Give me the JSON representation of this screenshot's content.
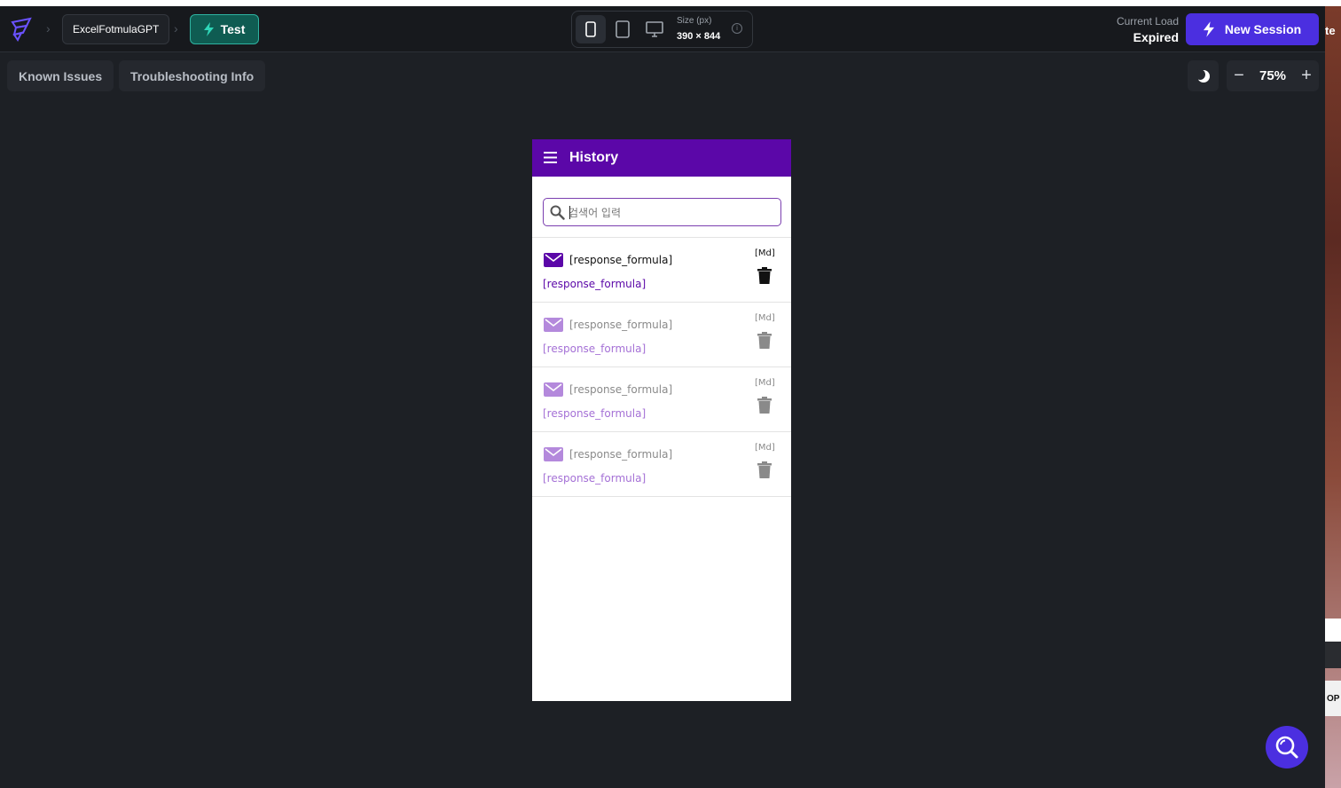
{
  "header": {
    "project_name": "ExcelFotmulaGPT",
    "env_label": "Test",
    "size_label": "Size (px)",
    "size_value": "390 × 844",
    "load_label": "Current Load",
    "load_value": "Expired",
    "new_session_label": "New Session"
  },
  "toolbar": {
    "known_issues": "Known Issues",
    "troubleshooting": "Troubleshooting Info",
    "zoom_value": "75%",
    "zoom_minus": "−",
    "zoom_plus": "+"
  },
  "phone": {
    "appbar_title": "History",
    "search_placeholder": "검색어 입력",
    "items": [
      {
        "title": "[response_formula]",
        "subtitle": "[response_formula]",
        "tag": "[Md]"
      },
      {
        "title": "[response_formula]",
        "subtitle": "[response_formula]",
        "tag": "[Md]"
      },
      {
        "title": "[response_formula]",
        "subtitle": "[response_formula]",
        "tag": "[Md]"
      },
      {
        "title": "[response_formula]",
        "subtitle": "[response_formula]",
        "tag": "[Md]"
      }
    ]
  },
  "colors": {
    "accent": "#4b2fe0",
    "appbar": "#5b07a8",
    "test_badge": "#0f5c52"
  },
  "edge_text": {
    "top": "te",
    "bottom": "OP"
  }
}
